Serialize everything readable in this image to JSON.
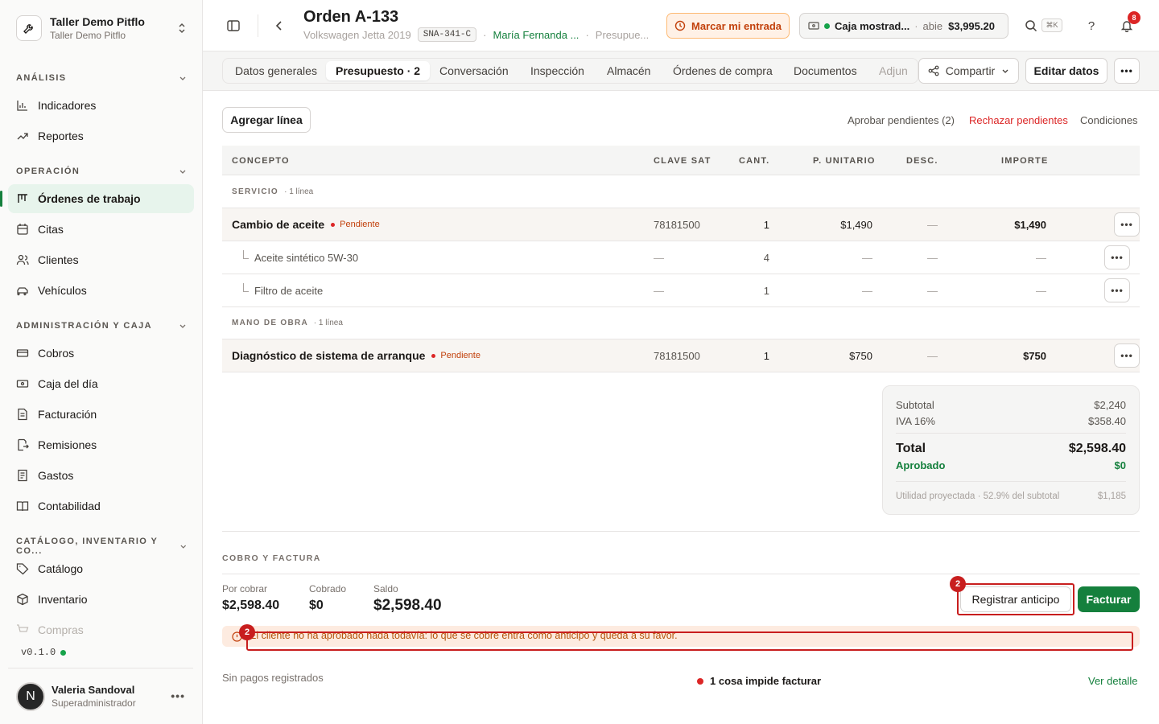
{
  "workspace": {
    "name": "Taller Demo Pitflo",
    "subtitle": "Taller Demo Pitflo"
  },
  "sidebar": {
    "sections": [
      {
        "label": "ANÁLISIS",
        "items": [
          {
            "label": "Indicadores",
            "icon": "bar-chart-icon"
          },
          {
            "label": "Reportes",
            "icon": "trend-icon"
          }
        ]
      },
      {
        "label": "OPERACIÓN",
        "items": [
          {
            "label": "Órdenes de trabajo",
            "icon": "kanban-icon",
            "active": true
          },
          {
            "label": "Citas",
            "icon": "calendar-icon"
          },
          {
            "label": "Clientes",
            "icon": "users-icon"
          },
          {
            "label": "Vehículos",
            "icon": "car-icon"
          }
        ]
      },
      {
        "label": "ADMINISTRACIÓN Y CAJA",
        "items": [
          {
            "label": "Cobros",
            "icon": "banknote-icon"
          },
          {
            "label": "Caja del día",
            "icon": "cash-register-icon"
          },
          {
            "label": "Facturación",
            "icon": "invoice-icon"
          },
          {
            "label": "Remisiones",
            "icon": "file-out-icon"
          },
          {
            "label": "Gastos",
            "icon": "receipt-icon"
          },
          {
            "label": "Contabilidad",
            "icon": "book-icon"
          }
        ]
      },
      {
        "label": "CATÁLOGO, INVENTARIO Y CO...",
        "items": [
          {
            "label": "Catálogo",
            "icon": "tag-icon"
          },
          {
            "label": "Inventario",
            "icon": "box-icon"
          },
          {
            "label": "Compras",
            "icon": "cart-icon"
          }
        ]
      }
    ],
    "version": "v0.1.0",
    "user": {
      "initial": "N",
      "name": "Valeria Sandoval",
      "role": "Superadministrador"
    }
  },
  "header": {
    "title": "Orden A-133",
    "vehicle": "Volkswagen Jetta 2019",
    "plate": "SNA-341-C",
    "client": "María Fernanda ...",
    "stage": "Presupue...",
    "mark_entry": "Marcar mi entrada",
    "caja": {
      "name": "Caja mostrad...",
      "status": "abie",
      "amount": "$3,995.20"
    },
    "shortcut": "⌘K",
    "help": "?",
    "notifications": "8"
  },
  "tabs": [
    "Datos generales",
    "Presupuesto · 2",
    "Conversación",
    "Inspección",
    "Almacén",
    "Órdenes de compra",
    "Documentos",
    "Adjun"
  ],
  "actions": {
    "share": "Compartir",
    "edit": "Editar datos"
  },
  "toolbar": {
    "add_line": "Agregar línea",
    "approve": "Aprobar pendientes (2)",
    "reject": "Rechazar pendientes",
    "conditions": "Condiciones"
  },
  "table": {
    "headers": {
      "concept": "CONCEPTO",
      "sat": "CLAVE SAT",
      "qty": "CANT.",
      "unit": "P. UNITARIO",
      "disc": "DESC.",
      "amount": "IMPORTE"
    },
    "group1": {
      "name": "SERVICIO",
      "count": "· 1 línea"
    },
    "row1": {
      "concept": "Cambio de aceite",
      "status": "Pendiente",
      "sat": "78181500",
      "qty": "1",
      "unit": "$1,490",
      "disc": "—",
      "amount": "$1,490"
    },
    "sub1": {
      "concept": "Aceite sintético 5W-30",
      "sat": "—",
      "qty": "4",
      "unit": "—",
      "disc": "—",
      "amount": "—"
    },
    "sub2": {
      "concept": "Filtro de aceite",
      "sat": "—",
      "qty": "1",
      "unit": "—",
      "disc": "—",
      "amount": "—"
    },
    "group2": {
      "name": "MANO DE OBRA",
      "count": "· 1 línea"
    },
    "row2": {
      "concept": "Diagnóstico de sistema de arranque",
      "status": "Pendiente",
      "sat": "78181500",
      "qty": "1",
      "unit": "$750",
      "disc": "—",
      "amount": "$750"
    }
  },
  "totals": {
    "subtotal_label": "Subtotal",
    "subtotal": "$2,240",
    "iva_label": "IVA 16%",
    "iva": "$358.40",
    "total_label": "Total",
    "total": "$2,598.40",
    "approved_label": "Aprobado",
    "approved": "$0",
    "profit_label": "Utilidad proyectada · 52.9% del subtotal",
    "profit": "$1,185"
  },
  "billing": {
    "title": "COBRO Y FACTURA",
    "por_cobrar_label": "Por cobrar",
    "por_cobrar": "$2,598.40",
    "cobrado_label": "Cobrado",
    "cobrado": "$0",
    "saldo_label": "Saldo",
    "saldo": "$2,598.40",
    "register": "Registrar anticipo",
    "invoice": "Facturar",
    "alert": "El cliente no ha aprobado nada todavía: lo que se cobre entra como anticipo y queda a su favor.",
    "no_payments": "Sin pagos registrados",
    "blocker": "1 cosa impide facturar",
    "detail": "Ver detalle"
  },
  "annotations": {
    "label_a": "2",
    "label_b": "2"
  },
  "colors": {
    "accent": "#15803d",
    "pending": "#c2410c",
    "danger": "#c81e1e"
  }
}
